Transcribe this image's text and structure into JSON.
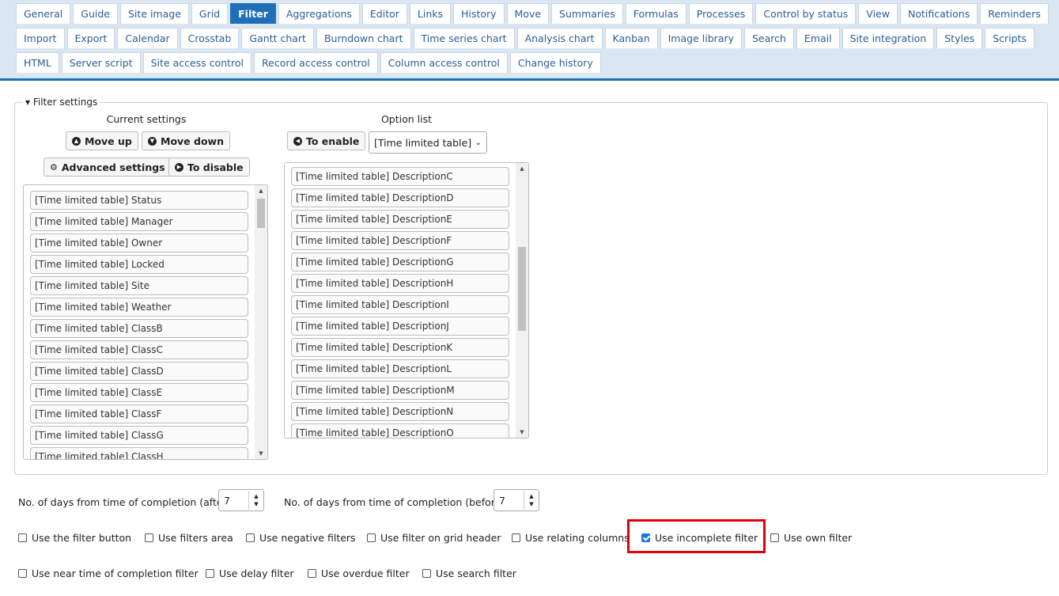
{
  "tabs": {
    "row1": [
      "General",
      "Guide",
      "Site image",
      "Grid",
      "Filter",
      "Aggregations",
      "Editor",
      "Links",
      "History",
      "Move",
      "Summaries",
      "Formulas",
      "Processes",
      "Control by status",
      "View",
      "Notifications",
      "Reminders"
    ],
    "row2": [
      "Import",
      "Export",
      "Calendar",
      "Crosstab",
      "Gantt chart",
      "Burndown chart",
      "Time series chart",
      "Analysis chart",
      "Kanban",
      "Image library",
      "Search",
      "Email",
      "Site integration",
      "Styles",
      "Scripts"
    ],
    "row3": [
      "HTML",
      "Server script",
      "Site access control",
      "Record access control",
      "Column access control",
      "Change history"
    ],
    "active": "Filter"
  },
  "filter_settings": {
    "legend": "Filter settings",
    "current_caption": "Current settings",
    "option_caption": "Option list",
    "buttons": {
      "move_up": "Move up",
      "move_down": "Move down",
      "advanced": "Advanced settings",
      "to_disable": "To disable",
      "to_enable": "To enable"
    },
    "option_select": "[Time limited table]",
    "current_items": [
      "[Time limited table] Status",
      "[Time limited table] Manager",
      "[Time limited table] Owner",
      "[Time limited table] Locked",
      "[Time limited table] Site",
      "[Time limited table] Weather",
      "[Time limited table] ClassB",
      "[Time limited table] ClassC",
      "[Time limited table] ClassD",
      "[Time limited table] ClassE",
      "[Time limited table] ClassF",
      "[Time limited table] ClassG",
      "[Time limited table] ClassH"
    ],
    "option_items": [
      "[Time limited table] DescriptionC",
      "[Time limited table] DescriptionD",
      "[Time limited table] DescriptionE",
      "[Time limited table] DescriptionF",
      "[Time limited table] DescriptionG",
      "[Time limited table] DescriptionH",
      "[Time limited table] DescriptionI",
      "[Time limited table] DescriptionJ",
      "[Time limited table] DescriptionK",
      "[Time limited table] DescriptionL",
      "[Time limited table] DescriptionM",
      "[Time limited table] DescriptionN",
      "[Time limited table] DescriptionO"
    ]
  },
  "days": {
    "after_label": "No. of days from time of completion (after)",
    "after_value": "7",
    "before_label": "No. of days from time of completion (before)",
    "before_value": "7"
  },
  "checkboxes": {
    "filter_button": {
      "label": "Use the filter button",
      "checked": false
    },
    "filters_area": {
      "label": "Use filters area",
      "checked": false
    },
    "negative_filters": {
      "label": "Use negative filters",
      "checked": false
    },
    "grid_header": {
      "label": "Use filter on grid header",
      "checked": false
    },
    "relating_columns": {
      "label": "Use relating columns",
      "checked": false
    },
    "incomplete_filter": {
      "label": "Use incomplete filter",
      "checked": true
    },
    "own_filter": {
      "label": "Use own filter",
      "checked": false
    },
    "near_completion": {
      "label": "Use near time of completion filter",
      "checked": false
    },
    "delay_filter": {
      "label": "Use delay filter",
      "checked": false
    },
    "overdue_filter": {
      "label": "Use overdue filter",
      "checked": false
    },
    "search_filter": {
      "label": "Use search filter",
      "checked": false
    }
  },
  "colors": {
    "accent": "#1f6fb8",
    "tab_bg": "#dbe6f3",
    "highlight": "#e0000a",
    "checkbox": "#1a73e8"
  }
}
